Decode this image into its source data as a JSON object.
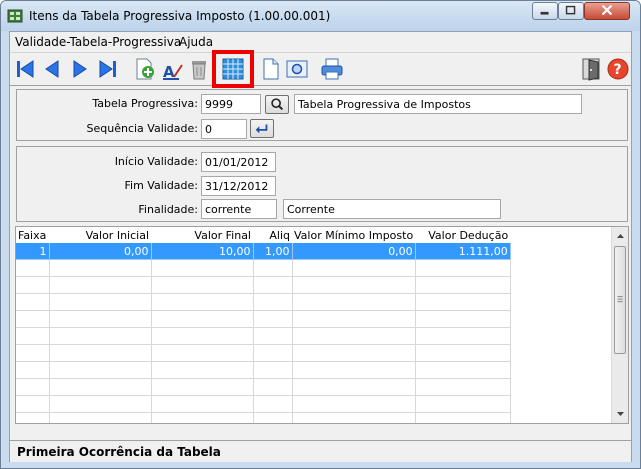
{
  "window": {
    "title": "Itens da Tabela Progressiva Imposto (1.00.00.001)"
  },
  "menu": {
    "items": [
      "Validade-Tabela-Progressiva",
      "Ajuda"
    ]
  },
  "toolbar": {
    "buttons": [
      "first-record-icon",
      "previous-record-icon",
      "next-record-icon",
      "last-record-icon",
      "add-record-icon",
      "edit-record-icon",
      "delete-record-icon",
      "calculator-grid-icon",
      "new-document-icon",
      "print-preview-icon",
      "print-icon",
      "exit-door-icon",
      "help-icon"
    ],
    "highlighted": "calculator-grid-icon",
    "highlight_color": "#e00000"
  },
  "form": {
    "tabela_label": "Tabela Progressiva:",
    "tabela_code": "9999",
    "tabela_desc": "Tabela Progressiva de Impostos",
    "sequencia_label": "Sequência Validade:",
    "sequencia_value": "0",
    "inicio_label": "Início Validade:",
    "inicio_value": "01/01/2012",
    "fim_label": "Fim Validade:",
    "fim_value": "31/12/2012",
    "finalidade_label": "Finalidade:",
    "finalidade_code": "corrente",
    "finalidade_desc": "Corrente"
  },
  "grid": {
    "columns": [
      "Faixa",
      "Valor Inicial",
      "Valor Final",
      "Aliq",
      "Valor Mínimo Imposto",
      "Valor Dedução"
    ],
    "rows": [
      [
        "1",
        "0,00",
        "10,00",
        "1,00",
        "0,00",
        "1.111,00"
      ]
    ],
    "selection_color": "#3399ff"
  },
  "status": {
    "text": "Primeira Ocorrência da Tabela"
  }
}
